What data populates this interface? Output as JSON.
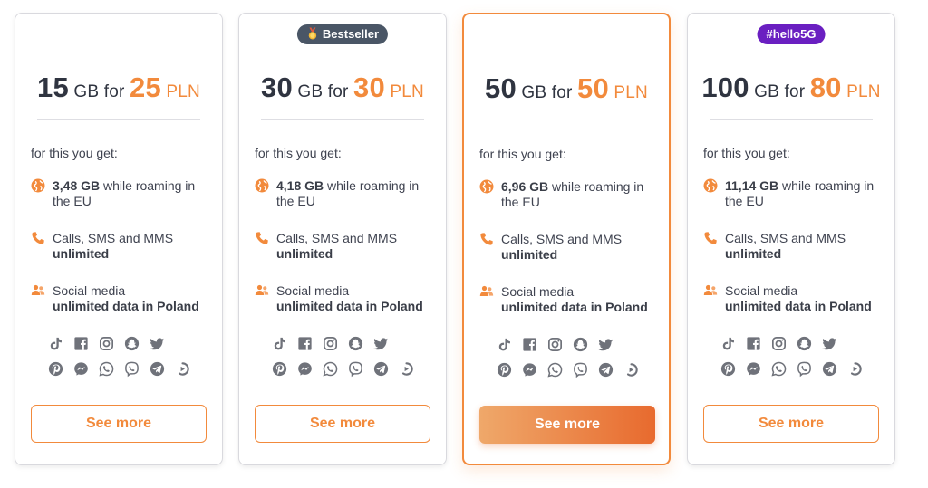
{
  "colors": {
    "accent": "#f28a3c",
    "badge_dark": "#4a5666",
    "badge_purple": "#6a1fc1",
    "text": "#3f4350"
  },
  "common": {
    "for_you": "for this you get:",
    "roaming_suffix": "while roaming in the EU",
    "calls_label": "Calls, SMS and MMS",
    "calls_value": "unlimited",
    "social_label": "Social media",
    "social_value": "unlimited data in Poland",
    "button": "See more",
    "word_for": "for",
    "unit_gb": "GB",
    "unit_pln": "PLN"
  },
  "social_icons_row1": [
    "tiktok-icon",
    "facebook-icon",
    "instagram-icon",
    "snapchat-icon",
    "twitter-icon"
  ],
  "social_icons_row2": [
    "pinterest-icon",
    "messenger-icon",
    "whatsapp-icon",
    "viber-icon",
    "telegram-icon",
    "play-icon"
  ],
  "plans": [
    {
      "gb": "15",
      "pln": "25",
      "roaming": "3,48 GB",
      "badge": ""
    },
    {
      "gb": "30",
      "pln": "30",
      "roaming": "4,18 GB",
      "badge": "Bestseller"
    },
    {
      "gb": "50",
      "pln": "50",
      "roaming": "6,96 GB",
      "badge": ""
    },
    {
      "gb": "100",
      "pln": "80",
      "roaming": "11,14 GB",
      "badge": "#hello5G"
    }
  ]
}
